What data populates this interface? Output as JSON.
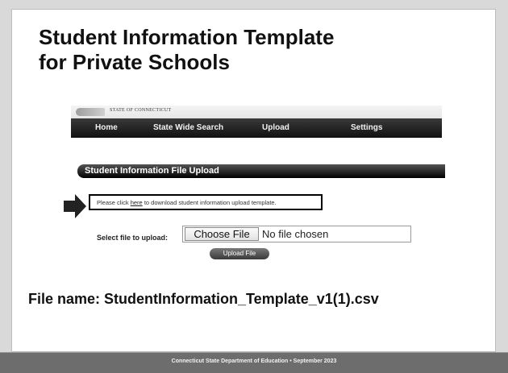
{
  "slide": {
    "title_line1": "Student Information Template",
    "title_line2": "for Private Schools",
    "file_name": "File name: StudentInformation_Template_v1(1).csv"
  },
  "screenshot": {
    "banner": {
      "state_text": "STATE OF CONNECTICUT"
    },
    "nav": [
      {
        "label": "Home"
      },
      {
        "label": "State Wide Search"
      },
      {
        "label": "Upload"
      },
      {
        "label": "Settings"
      }
    ],
    "panel_title": "Student Information File Upload",
    "notice": {
      "prefix": "Please click",
      "link": "here",
      "suffix": "to download student information upload template."
    },
    "select_label": "Select file to upload:",
    "choose_button": "Choose File",
    "no_file_text": "No file chosen",
    "upload_button": "Upload File",
    "arrow_icon": "right-arrow-icon"
  },
  "footer": {
    "text": "Connecticut State Department of Education • September 2023"
  },
  "colors": {
    "navbar": "#1a1a1a",
    "footer": "#6d6d6d",
    "slide_bg": "#ffffff"
  }
}
